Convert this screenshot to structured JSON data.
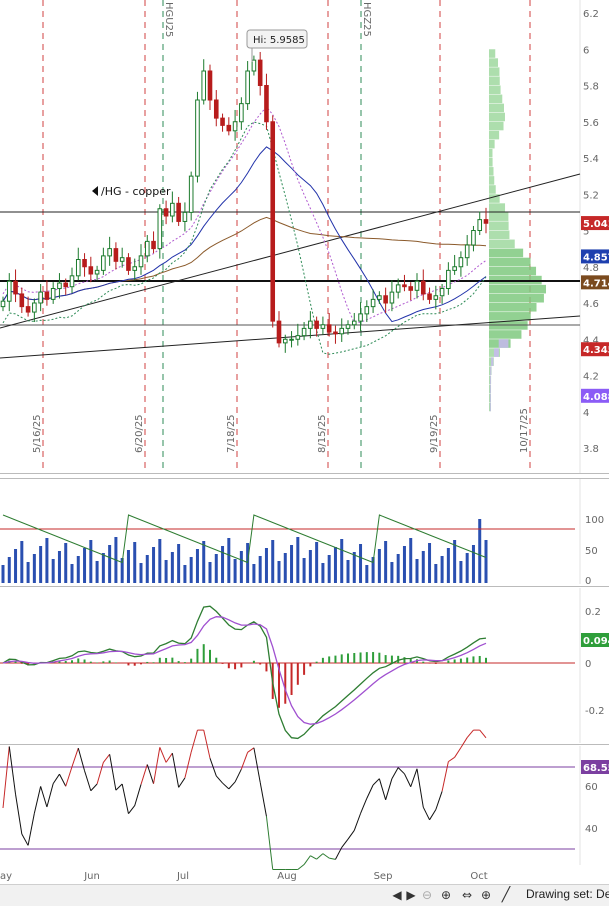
{
  "chart_data": [
    {
      "type": "candlestick",
      "symbol_label": "/HG - copper",
      "annotation_high": "Hi: 5.9585",
      "ylim": [
        3.7,
        6.25
      ],
      "y_ticks": [
        "6.2",
        "6",
        "5.8",
        "5.6",
        "5.4",
        "5.2",
        "5",
        "4.8",
        "4.6",
        "4.4",
        "4.2",
        "4",
        "3.8"
      ],
      "price_badges": [
        {
          "value": "5.041",
          "color": "#c62828"
        },
        {
          "value": "4.857",
          "color": "#1e40af"
        },
        {
          "value": "4.714",
          "color": "#7a4a1e"
        },
        {
          "value": "4.345",
          "color": "#c62828"
        },
        {
          "value": "4.088",
          "color": "#8b5cf6"
        }
      ],
      "rollover_labels": [
        "HGU25",
        "HGZ25"
      ],
      "date_markers": [
        "5/16/25",
        "6/20/25",
        "7/18/25",
        "8/15/25",
        "9/19/25",
        "10/17/25"
      ],
      "close": [
        4.61,
        4.72,
        4.65,
        4.58,
        4.55,
        4.6,
        4.66,
        4.62,
        4.68,
        4.71,
        4.69,
        4.75,
        4.84,
        4.8,
        4.76,
        4.78,
        4.86,
        4.9,
        4.83,
        4.85,
        4.78,
        4.8,
        4.86,
        4.94,
        4.9,
        5.12,
        5.08,
        5.15,
        5.05,
        5.1,
        5.3,
        5.72,
        5.88,
        5.72,
        5.62,
        5.58,
        5.55,
        5.6,
        5.7,
        5.88,
        5.94,
        5.8,
        5.6,
        4.5,
        4.38,
        4.4,
        4.4,
        4.42,
        4.46,
        4.5,
        4.46,
        4.48,
        4.44,
        4.43,
        4.46,
        4.48,
        4.5,
        4.54,
        4.58,
        4.62,
        4.64,
        4.6,
        4.66,
        4.7,
        4.69,
        4.67,
        4.72,
        4.65,
        4.62,
        4.64,
        4.68,
        4.78,
        4.8,
        4.85,
        4.92,
        5.0,
        5.06,
        5.04
      ],
      "volume_panel": {
        "y_ticks": [
          "100",
          "50",
          "0"
        ]
      },
      "macd_panel": {
        "badge": "0.094",
        "y_ticks": [
          "0.2",
          "0",
          "-0.2"
        ]
      },
      "rsi_panel": {
        "badge": "68.55",
        "y_ticks": [
          "60",
          "40"
        ]
      },
      "x_labels": [
        "ay",
        "Jun",
        "Jul",
        "Aug",
        "Sep",
        "Oct"
      ]
    }
  ],
  "toolbar": {
    "drawing_set_label": "Drawing set: Det",
    "scroll_left_icon": "triangle-left",
    "scroll_right_icon": "triangle-right",
    "zoom_out_icon": "magnifier-minus",
    "zoom_in_icon": "magnifier-plus",
    "pan_icon": "horizontal-arrows",
    "crosshair_icon": "crosshair",
    "draw_icon": "pencil-line"
  }
}
